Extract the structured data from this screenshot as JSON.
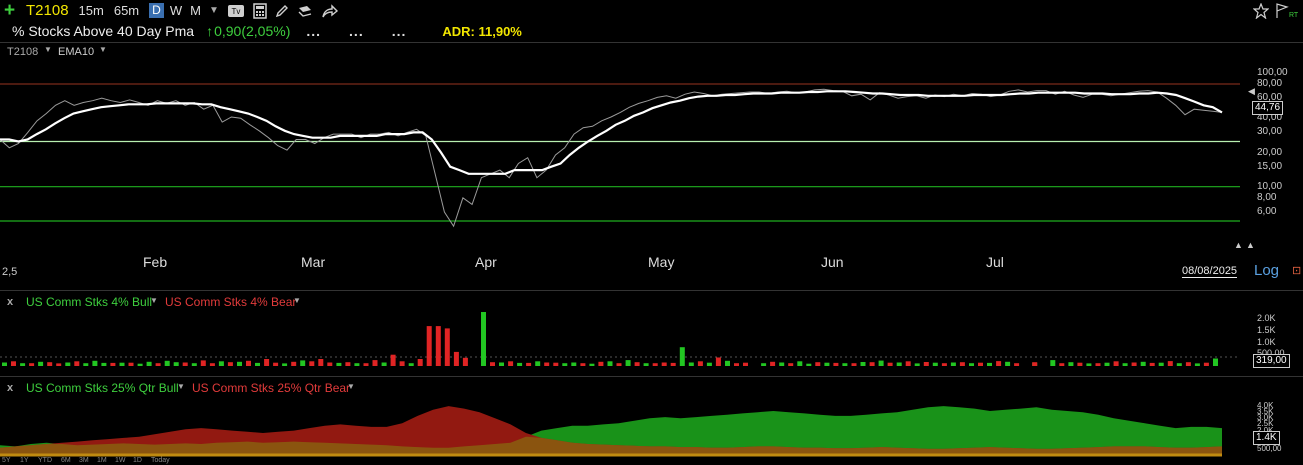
{
  "toolbar": {
    "symbol": "T2108",
    "tf_15m": "15m",
    "tf_65m": "65m",
    "tf_d": "D",
    "tf_w": "W",
    "tf_m": "M",
    "caret": "▼",
    "tv_label": "Tv"
  },
  "header": {
    "title": "% Stocks Above 40 Day Pma",
    "change_arrow": "↑",
    "change": "0,90(2,05%)",
    "dots1": "...",
    "dots2": "...",
    "dots3": "...",
    "adr": "ADR: 11,90%"
  },
  "price_panel": {
    "symbol_label": "T2108",
    "ema_label": "EMA10",
    "axis_labels": [
      "100,00",
      "80,00",
      "60,00",
      "40,00",
      "30,00",
      "20,00",
      "15,00",
      "10,00",
      "8,00",
      "6,00"
    ],
    "last_value": "44,76",
    "months": [
      "Feb",
      "Mar",
      "Apr",
      "May",
      "Jun",
      "Jul"
    ],
    "date": "08/08/2025",
    "log_label": "Log",
    "left_icon": "2,5"
  },
  "indicator1": {
    "close": "x",
    "bull_label": "US Comm Stks 4% Bull",
    "bear_label": "US Comm Stks 4% Bear",
    "axis_labels": [
      "2.0K",
      "1.5K",
      "1.0K",
      "500,00"
    ],
    "last_value": "319,00"
  },
  "indicator2": {
    "close": "x",
    "bull_label": "US Comm Stks 25% Qtr Bull",
    "bear_label": "US Comm Stks 25% Qtr Bear",
    "axis_labels": [
      "4.0K",
      "3.5K",
      "3.0K",
      "2.5K",
      "2.0K",
      "500,00"
    ],
    "last_value": "1.4K"
  },
  "range_buttons": [
    "5Y",
    "1Y",
    "YTD",
    "6M",
    "3M",
    "1M",
    "1W",
    "1D",
    "Today"
  ],
  "colors": {
    "bull": "#22c622",
    "bear": "#e02424",
    "accent": "#f2e600",
    "ema": "#ffffff",
    "price": "#9a9a9a"
  },
  "chart_data": [
    {
      "type": "line",
      "title": "% Stocks Above 40 Day Pma",
      "xlabel": "",
      "ylabel": "",
      "scale": "log",
      "ylim": [
        4,
        130
      ],
      "months": [
        "Feb",
        "Mar",
        "Apr",
        "May",
        "Jun",
        "Jul"
      ],
      "reference_lines": [
        80,
        25,
        10,
        5
      ],
      "series": [
        {
          "name": "T2108",
          "values": [
            26,
            22,
            24,
            30,
            38,
            44,
            52,
            57,
            52,
            55,
            57,
            60,
            57,
            55,
            58,
            55,
            52,
            57,
            54,
            57,
            52,
            55,
            48,
            52,
            37,
            41,
            40,
            35,
            31,
            27,
            23,
            21,
            26,
            26,
            24,
            27,
            29,
            29,
            29,
            27,
            29,
            29,
            30,
            28,
            30,
            32,
            28,
            13,
            6,
            4.5,
            8,
            7,
            12,
            13,
            14,
            12,
            16,
            18,
            12,
            14,
            19,
            22,
            29,
            33,
            34,
            38,
            41,
            45,
            50,
            54,
            57,
            61,
            63,
            60,
            65,
            68,
            66,
            63,
            65,
            66,
            67,
            68,
            68,
            66,
            68,
            69,
            67,
            68,
            71,
            72,
            70,
            69,
            63,
            65,
            58,
            67,
            64,
            60,
            62,
            63,
            60,
            64,
            62,
            65,
            63,
            66,
            65,
            62,
            64,
            69,
            71,
            68,
            70,
            70,
            65,
            69,
            64,
            61,
            65,
            65,
            63,
            65,
            67,
            69,
            70,
            68,
            60,
            52,
            43,
            48,
            47,
            46,
            45
          ]
        },
        {
          "name": "EMA10",
          "values": [
            26,
            26,
            25,
            26,
            29,
            32,
            36,
            40,
            44,
            46,
            48,
            50,
            51,
            52,
            53,
            53,
            53,
            54,
            54,
            54,
            54,
            54,
            53,
            53,
            50,
            48,
            46,
            44,
            41,
            38,
            34,
            31,
            29,
            28,
            27,
            27,
            27,
            28,
            28,
            28,
            28,
            28,
            29,
            29,
            29,
            30,
            30,
            26,
            20,
            15,
            14,
            13,
            13,
            13,
            13,
            13,
            14,
            14,
            14,
            14,
            15,
            16,
            19,
            22,
            25,
            28,
            31,
            35,
            38,
            42,
            45,
            49,
            52,
            55,
            57,
            60,
            62,
            63,
            63,
            64,
            64,
            65,
            66,
            66,
            66,
            67,
            67,
            67,
            68,
            68,
            69,
            69,
            69,
            68,
            67,
            66,
            66,
            65,
            64,
            64,
            64,
            63,
            63,
            63,
            63,
            63,
            64,
            64,
            64,
            64,
            65,
            66,
            66,
            67,
            67,
            67,
            67,
            67,
            66,
            66,
            66,
            65,
            65,
            65,
            66,
            66,
            67,
            66,
            64,
            60,
            56,
            52,
            50,
            45
          ]
        }
      ]
    },
    {
      "type": "bar",
      "title": "",
      "ylim": [
        0,
        2300
      ],
      "series": [
        {
          "name": "US Comm Stks 4% Bull",
          "values": [
            150,
            0,
            120,
            0,
            180,
            0,
            0,
            150,
            0,
            120,
            220,
            130,
            0,
            140,
            0,
            100,
            180,
            0,
            220,
            160,
            0,
            120,
            0,
            0,
            200,
            0,
            180,
            0,
            130,
            0,
            0,
            110,
            0,
            240,
            0,
            0,
            0,
            130,
            0,
            120,
            0,
            0,
            150,
            0,
            0,
            120,
            0,
            0,
            0,
            0,
            0,
            0,
            0,
            2300,
            0,
            150,
            0,
            130,
            0,
            200,
            0,
            0,
            120,
            150,
            0,
            100,
            0,
            200,
            0,
            250,
            0,
            120,
            0,
            0,
            0,
            800,
            150,
            0,
            140,
            0,
            220,
            0,
            0,
            0,
            120,
            0,
            150,
            0,
            200,
            100,
            0,
            140,
            0,
            120,
            0,
            170,
            0,
            230,
            0,
            150,
            0,
            110,
            0,
            140,
            0,
            150,
            0,
            120,
            0,
            130,
            0,
            180,
            0,
            0,
            140,
            0,
            250,
            0,
            160,
            0,
            110,
            0,
            140,
            0,
            120,
            0,
            180,
            0,
            140,
            0,
            120,
            0,
            110,
            0,
            319
          ]
        },
        {
          "name": "US Comm Stks 4% Bear",
          "values": [
            0,
            200,
            0,
            120,
            0,
            160,
            110,
            0,
            200,
            0,
            0,
            0,
            130,
            0,
            140,
            0,
            0,
            120,
            0,
            0,
            150,
            0,
            240,
            120,
            0,
            160,
            0,
            220,
            0,
            300,
            140,
            0,
            180,
            0,
            200,
            300,
            150,
            0,
            160,
            0,
            120,
            250,
            0,
            480,
            200,
            0,
            300,
            1700,
            1700,
            1600,
            600,
            350,
            0,
            0,
            160,
            0,
            200,
            0,
            130,
            0,
            150,
            140,
            0,
            0,
            120,
            0,
            180,
            0,
            120,
            0,
            160,
            0,
            120,
            150,
            130,
            0,
            0,
            200,
            0,
            360,
            0,
            120,
            140,
            0,
            0,
            180,
            0,
            120,
            0,
            0,
            160,
            0,
            130,
            0,
            120,
            0,
            160,
            0,
            140,
            0,
            200,
            0,
            170,
            0,
            120,
            0,
            160,
            0,
            140,
            0,
            210,
            0,
            120,
            0,
            160,
            0,
            0,
            120,
            0,
            140,
            0,
            120,
            0,
            200,
            0,
            150,
            0,
            130,
            0,
            210,
            0,
            160,
            0,
            140,
            0,
            120,
            0
          ]
        }
      ]
    },
    {
      "type": "area",
      "title": "",
      "ylim": [
        0,
        4500
      ],
      "series": [
        {
          "name": "US Comm Stks 25% Qtr Bull",
          "values": [
            800,
            700,
            900,
            1000,
            900,
            800,
            850,
            900,
            950,
            900,
            850,
            900,
            950,
            900,
            1000,
            1050,
            1100,
            1000,
            1050,
            1100,
            1050,
            1000,
            950,
            900,
            850,
            800,
            700,
            650,
            600,
            600,
            700,
            800,
            900,
            1000,
            1500,
            2000,
            2200,
            2400,
            2400,
            2500,
            2600,
            2800,
            3000,
            3100,
            3000,
            3100,
            3200,
            3300,
            3400,
            3500,
            3600,
            3500,
            3400,
            3300,
            3200,
            3200,
            3300,
            3400,
            3500,
            3700,
            3900,
            4000,
            3900,
            3800,
            3600,
            3700,
            3800,
            3900,
            3700,
            3600,
            3500,
            3300,
            3000,
            2800,
            2600,
            2400,
            2200,
            2300,
            2300,
            2200
          ]
        },
        {
          "name": "US Comm Stks 25% Qtr Bear",
          "values": [
            600,
            700,
            800,
            900,
            1000,
            1100,
            1200,
            1300,
            1400,
            1500,
            1700,
            1900,
            2100,
            2200,
            2100,
            2000,
            1900,
            1800,
            1900,
            2000,
            2200,
            2400,
            2500,
            2400,
            2300,
            2300,
            2600,
            3200,
            3700,
            4000,
            3800,
            3500,
            3000,
            2500,
            1800,
            1400,
            1200,
            1000,
            900,
            850,
            800,
            750,
            700,
            700,
            650,
            650,
            600,
            600,
            650,
            700,
            700,
            650,
            600,
            600,
            550,
            550,
            600,
            650,
            600,
            550,
            500,
            500,
            550,
            600,
            650,
            600,
            550,
            500,
            500,
            550,
            600,
            650,
            700,
            700,
            700,
            650,
            600,
            600,
            650,
            700
          ]
        }
      ]
    }
  ]
}
